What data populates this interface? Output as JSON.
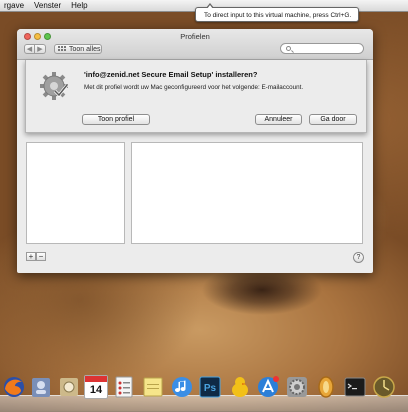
{
  "menubar": {
    "items": [
      "rgave",
      "Venster",
      "Help"
    ]
  },
  "tooltip": {
    "text": "To direct input to this virtual machine, press Ctrl+G."
  },
  "window": {
    "title": "Profielen",
    "toolbar": {
      "back_label": "◀",
      "forward_label": "▶",
      "show_all_label": "Toon alles",
      "search_placeholder": ""
    },
    "sheet": {
      "title": "'info@zenid.net Secure Email Setup' installeren?",
      "message": "Met dit profiel wordt uw Mac geconfigureerd voor het volgende: E-mailaccount.",
      "show_profile_label": "Toon profiel",
      "cancel_label": "Annuleer",
      "continue_label": "Ga door"
    },
    "footer": {
      "add_label": "+",
      "remove_label": "−",
      "help_label": "?"
    }
  },
  "dock": {
    "icons": [
      "firefox-icon",
      "contacts-icon",
      "preview-icon",
      "calendar-icon",
      "reminders-icon",
      "notes-icon",
      "itunes-icon",
      "photoshop-icon",
      "adium-icon",
      "app-store-icon",
      "system-preferences-icon",
      "oxygen-icon",
      "terminal-icon",
      "time-machine-icon"
    ],
    "calendar_day": "14"
  }
}
